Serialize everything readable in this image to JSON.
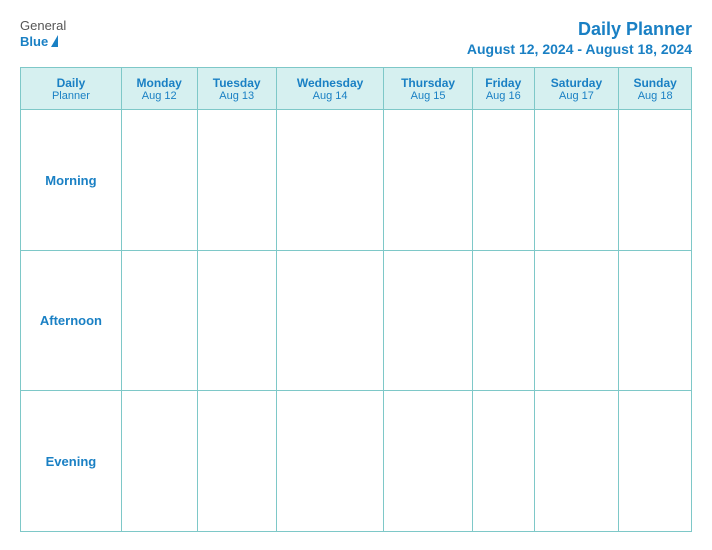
{
  "logo": {
    "general": "General",
    "blue": "Blue"
  },
  "title": {
    "main": "Daily Planner",
    "date_range": "August 12, 2024 - August 18, 2024"
  },
  "table": {
    "header_col": {
      "label1": "Daily",
      "label2": "Planner"
    },
    "days": [
      {
        "day": "Monday",
        "date": "Aug 12"
      },
      {
        "day": "Tuesday",
        "date": "Aug 13"
      },
      {
        "day": "Wednesday",
        "date": "Aug 14"
      },
      {
        "day": "Thursday",
        "date": "Aug 15"
      },
      {
        "day": "Friday",
        "date": "Aug 16"
      },
      {
        "day": "Saturday",
        "date": "Aug 17"
      },
      {
        "day": "Sunday",
        "date": "Aug 18"
      }
    ],
    "rows": [
      {
        "label": "Morning"
      },
      {
        "label": "Afternoon"
      },
      {
        "label": "Evening"
      }
    ]
  }
}
